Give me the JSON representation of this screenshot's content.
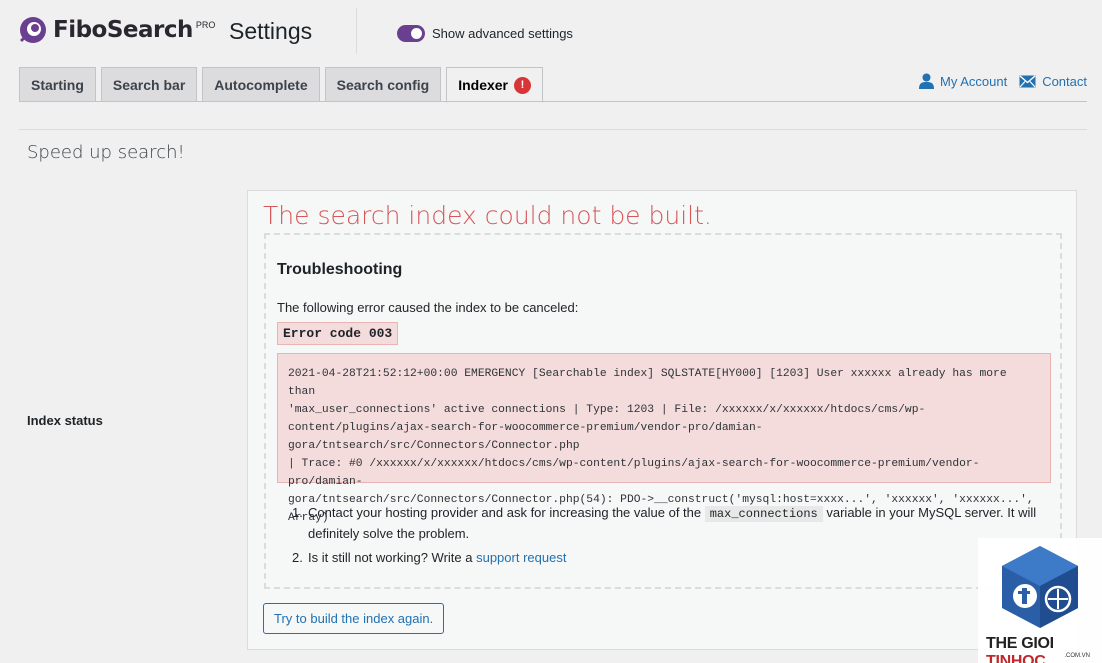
{
  "header": {
    "logo_text": "FiboSearch",
    "logo_badge": "PRO",
    "page_title": "Settings",
    "advanced_toggle_label": "Show advanced settings",
    "advanced_toggle_on": true
  },
  "tabs": [
    {
      "label": "Starting",
      "active": false
    },
    {
      "label": "Search bar",
      "active": false
    },
    {
      "label": "Autocomplete",
      "active": false
    },
    {
      "label": "Search config",
      "active": false
    },
    {
      "label": "Indexer",
      "active": true,
      "badge": "!"
    }
  ],
  "account_links": {
    "my_account": "My Account",
    "contact": "Contact"
  },
  "section": {
    "title": "Speed up search!",
    "field_label": "Index status"
  },
  "status": {
    "error_title": "The search index could not be built.",
    "troubleshooting_title": "Troubleshooting",
    "intro": "The following error caused the index to be canceled:",
    "error_code": "Error code 003",
    "trace_lines": [
      "2021-04-28T21:52:12+00:00 EMERGENCY [Searchable index] SQLSTATE[HY000] [1203] User xxxxxx already has more than",
      "'max_user_connections' active connections | Type: 1203 | File: /xxxxxx/x/xxxxxx/htdocs/cms/wp-",
      "content/plugins/ajax-search-for-woocommerce-premium/vendor-pro/damian-gora/tntsearch/src/Connectors/Connector.php",
      "| Trace: #0 /xxxxxx/x/xxxxxx/htdocs/cms/wp-content/plugins/ajax-search-for-woocommerce-premium/vendor-pro/damian-",
      "gora/tntsearch/src/Connectors/Connector.php(54): PDO->__construct('mysql:host=xxxx...', 'xxxxxx', 'xxxxxx...',",
      "Array)"
    ],
    "steps": {
      "step1_num": "1.",
      "step1_before": "Contact your hosting provider and ask for increasing the value of the ",
      "step1_code": "max_connections",
      "step1_after": " variable in your MySQL server. It will definitely solve the problem.",
      "step2_num": "2.",
      "step2_before": "Is it still not working? Write a ",
      "step2_link": "support request"
    },
    "retry_button": "Try to build the index again."
  },
  "watermark": {
    "text_part1": "THE GIOI ",
    "text_part2": "TINHOC",
    "sub": ".COM.VN"
  },
  "colors": {
    "brand_purple": "#6b3f8f",
    "error_red": "#d6565a",
    "link_blue": "#2271b1",
    "error_bg": "#f5dcdc"
  }
}
